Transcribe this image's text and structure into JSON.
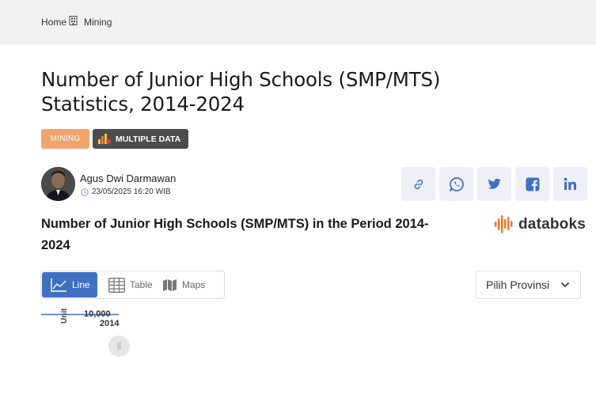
{
  "breadcrumb": {
    "home": "Home",
    "current": "Mining"
  },
  "page_title": "Number of Junior High Schools (SMP/MTS) Statistics, 2014-2024",
  "tags": {
    "category": "MINING",
    "multiple_data": "MULTIPLE DATA"
  },
  "author": {
    "name": "Agus Dwi Darmawan",
    "date": "23/05/2025 16:20 WIB"
  },
  "share_icons": [
    "link-icon",
    "whatsapp-icon",
    "twitter-icon",
    "facebook-icon",
    "linkedin-icon"
  ],
  "chart_heading": "Number of Junior High Schools (SMP/MTS) in the Period 2014-2024",
  "brand": "databoks",
  "view_tabs": {
    "line": "Line",
    "table": "Table",
    "maps": "Maps"
  },
  "province_select": "Pilih Provinsi",
  "colors": {
    "accent_blue": "#3f70c1",
    "mining_tag": "#f2a26c",
    "dark_tag": "#4d4d4d",
    "databoks_orange": "#f0762b"
  },
  "chart_data": {
    "type": "line",
    "ylabel": "Unit",
    "y_ticks": [
      "10,000"
    ],
    "x_ticks": [
      "2014"
    ],
    "slider_handle_label": "||"
  }
}
